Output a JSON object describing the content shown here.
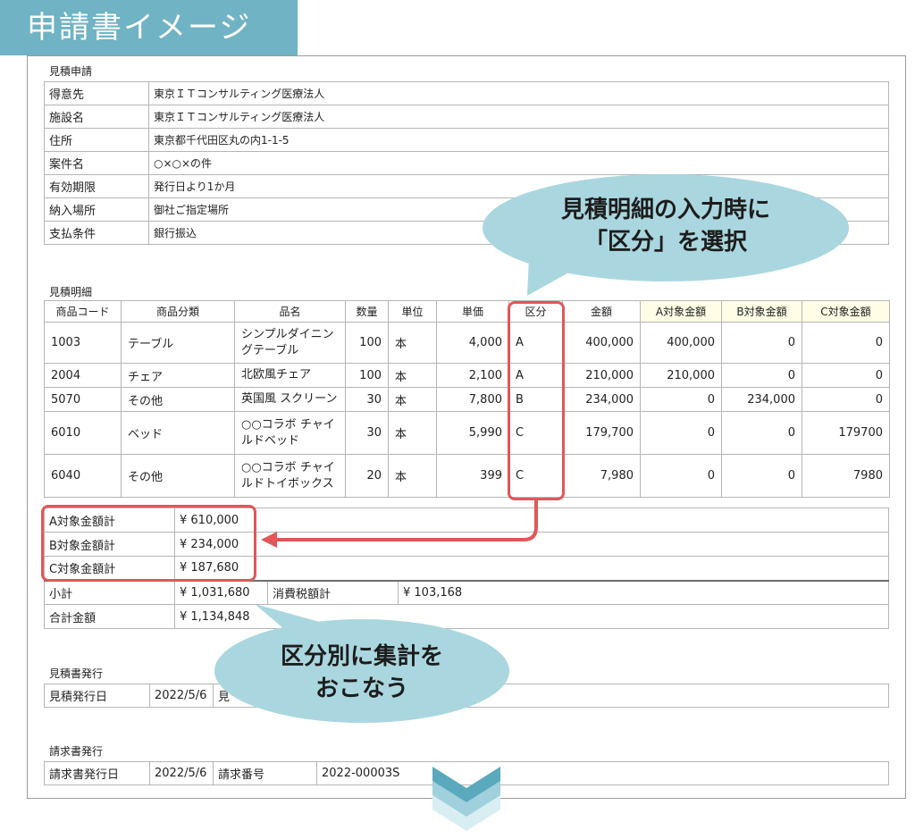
{
  "banner": {
    "title": "申請書イメージ"
  },
  "estimate": {
    "section": "見積申請",
    "rows": [
      {
        "label": "得意先",
        "value": "東京ＩＴコンサルティング医療法人"
      },
      {
        "label": "施設名",
        "value": "東京ＩＴコンサルティング医療法人"
      },
      {
        "label": "住所",
        "value": "東京都千代田区丸の内1-1-5"
      },
      {
        "label": "案件名",
        "value": "○×○×の件"
      },
      {
        "label": "有効期限",
        "value": "発行日より1か月"
      },
      {
        "label": "納入場所",
        "value": "御社ご指定場所"
      },
      {
        "label": "支払条件",
        "value": "銀行振込"
      }
    ]
  },
  "detail": {
    "section": "見積明細",
    "headers": [
      "商品コード",
      "商品分類",
      "品名",
      "数量",
      "単位",
      "単価",
      "区分",
      "金額",
      "A対象金額",
      "B対象金額",
      "C対象金額"
    ],
    "rows": [
      {
        "code": "1003",
        "category": "テーブル",
        "name": "シンプルダイニングテーブル",
        "qty": "100",
        "unit": "本",
        "price": "4,000",
        "kubun": "A",
        "amount": "400,000",
        "a": "400,000",
        "b": "0",
        "c": "0"
      },
      {
        "code": "2004",
        "category": "チェア",
        "name": "北欧風チェア",
        "qty": "100",
        "unit": "本",
        "price": "2,100",
        "kubun": "A",
        "amount": "210,000",
        "a": "210,000",
        "b": "0",
        "c": "0"
      },
      {
        "code": "5070",
        "category": "その他",
        "name": "英国風 スクリーン",
        "qty": "30",
        "unit": "本",
        "price": "7,800",
        "kubun": "B",
        "amount": "234,000",
        "a": "0",
        "b": "234,000",
        "c": "0"
      },
      {
        "code": "6010",
        "category": "ベッド",
        "name": "○○コラボ チャイルドベッド",
        "qty": "30",
        "unit": "本",
        "price": "5,990",
        "kubun": "C",
        "amount": "179,700",
        "a": "0",
        "b": "0",
        "c": "179700"
      },
      {
        "code": "6040",
        "category": "その他",
        "name": "○○コラボ チャイルドトイボックス",
        "qty": "20",
        "unit": "本",
        "price": "399",
        "kubun": "C",
        "amount": "7,980",
        "a": "0",
        "b": "0",
        "c": "7980"
      }
    ]
  },
  "totals": {
    "a_label": "A対象金額計",
    "a_value": "¥ 610,000",
    "b_label": "B対象金額計",
    "b_value": "¥ 234,000",
    "c_label": "C対象金額計",
    "c_value": "¥ 187,680",
    "subtotal_label": "小計",
    "subtotal_value": "¥ 1,031,680",
    "tax_label": "消費税額計",
    "tax_value": "¥ 103,168",
    "grand_label": "合計金額",
    "grand_value": "¥ 1,134,848"
  },
  "quote_issue": {
    "section": "見積書発行",
    "date_label": "見積発行日",
    "date_value": "2022/5/6",
    "partial": "見"
  },
  "invoice_issue": {
    "section": "請求書発行",
    "date_label": "請求書発行日",
    "date_value": "2022/5/6",
    "number_label": "請求番号",
    "number_value": "2022-00003S"
  },
  "callouts": {
    "top_line1": "見積明細の入力時に",
    "top_line2": "「区分」を選択",
    "bottom_line1": "区分別に集計を",
    "bottom_line2": "おこなう"
  },
  "colors": {
    "banner": "#6fb3c4",
    "callout": "#aad7df",
    "highlight": "#e0575a",
    "header_yellow": "#fffde6"
  }
}
